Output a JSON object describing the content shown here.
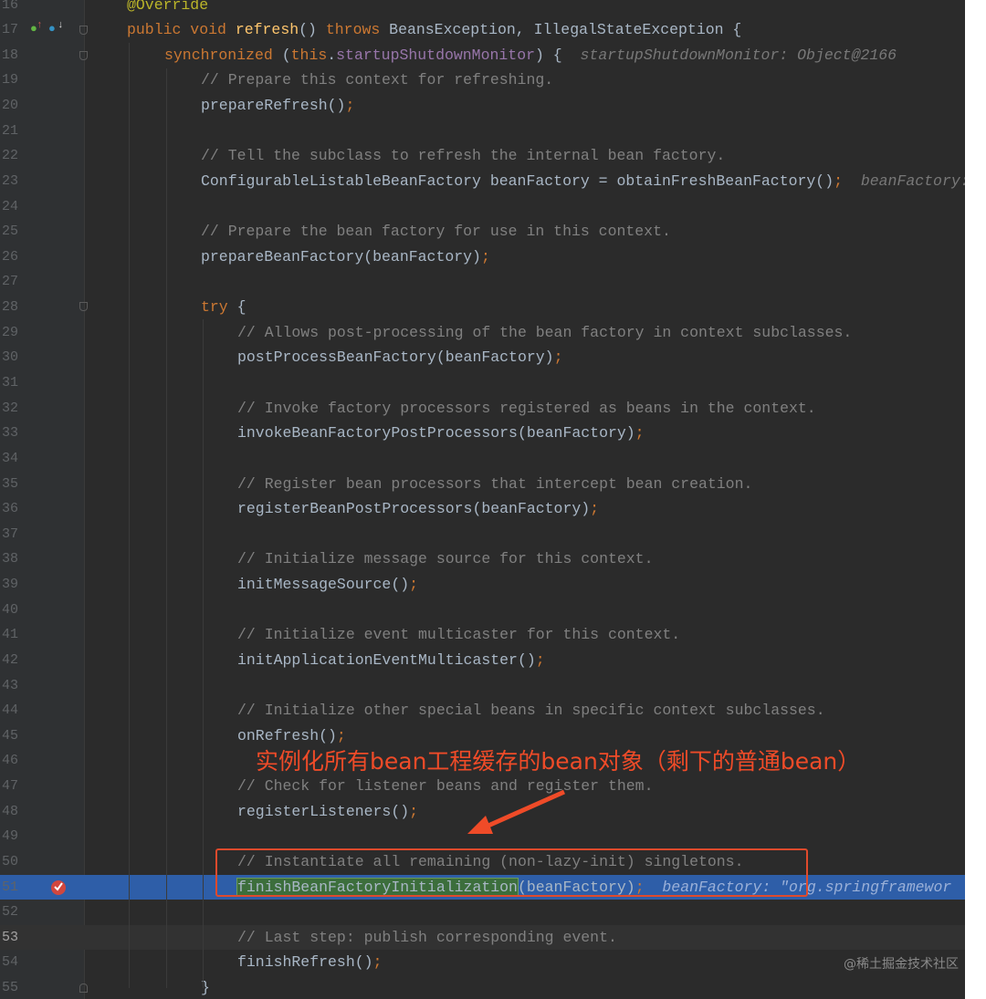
{
  "editor": {
    "first_line": 16,
    "current_line": 53,
    "highlighted_line": 51,
    "lines": [
      {
        "n": "16",
        "indent": 0,
        "t": [
          [
            "@Override",
            "an"
          ]
        ]
      },
      {
        "n": "17",
        "indent": 0,
        "t": [
          [
            "public void ",
            "kw"
          ],
          [
            "refresh",
            "fn"
          ],
          [
            "() ",
            "pl"
          ],
          [
            "throws ",
            "kw"
          ],
          [
            "BeansException, IllegalStateException {",
            "pl"
          ]
        ]
      },
      {
        "n": "18",
        "indent": 1,
        "t": [
          [
            "synchronized ",
            "kw"
          ],
          [
            "(",
            "pl"
          ],
          [
            "this",
            "kw"
          ],
          [
            ".",
            "pl"
          ],
          [
            "startupShutdownMonitor",
            "fld"
          ],
          [
            ") {  ",
            "pl"
          ],
          [
            "startupShutdownMonitor: Object@2166",
            "hint"
          ]
        ]
      },
      {
        "n": "19",
        "indent": 2,
        "t": [
          [
            "// Prepare this context for refreshing.",
            "cm"
          ]
        ]
      },
      {
        "n": "20",
        "indent": 2,
        "t": [
          [
            "prepareRefresh()",
            "pl"
          ],
          [
            ";",
            "kw"
          ]
        ]
      },
      {
        "n": "21",
        "indent": 0,
        "t": []
      },
      {
        "n": "22",
        "indent": 2,
        "t": [
          [
            "// Tell the subclass to refresh the internal bean factory.",
            "cm"
          ]
        ]
      },
      {
        "n": "23",
        "indent": 2,
        "t": [
          [
            "ConfigurableListableBeanFactory beanFactory = obtainFreshBeanFactory()",
            "pl"
          ],
          [
            ";",
            "kw"
          ],
          [
            "  beanFactory: \"org.springframework",
            "hint"
          ]
        ]
      },
      {
        "n": "24",
        "indent": 0,
        "t": []
      },
      {
        "n": "25",
        "indent": 2,
        "t": [
          [
            "// Prepare the bean factory for use in this context.",
            "cm"
          ]
        ]
      },
      {
        "n": "26",
        "indent": 2,
        "t": [
          [
            "prepareBeanFactory(beanFactory)",
            "pl"
          ],
          [
            ";",
            "kw"
          ]
        ]
      },
      {
        "n": "27",
        "indent": 0,
        "t": []
      },
      {
        "n": "28",
        "indent": 2,
        "t": [
          [
            "try ",
            "kw"
          ],
          [
            "{",
            "pl"
          ]
        ]
      },
      {
        "n": "29",
        "indent": 3,
        "t": [
          [
            "// Allows post-processing of the bean factory in context subclasses.",
            "cm"
          ]
        ]
      },
      {
        "n": "30",
        "indent": 3,
        "t": [
          [
            "postProcessBeanFactory(beanFactory)",
            "pl"
          ],
          [
            ";",
            "kw"
          ]
        ]
      },
      {
        "n": "31",
        "indent": 0,
        "t": []
      },
      {
        "n": "32",
        "indent": 3,
        "t": [
          [
            "// Invoke factory processors registered as beans in the context.",
            "cm"
          ]
        ]
      },
      {
        "n": "33",
        "indent": 3,
        "t": [
          [
            "invokeBeanFactoryPostProcessors(beanFactory)",
            "pl"
          ],
          [
            ";",
            "kw"
          ]
        ]
      },
      {
        "n": "34",
        "indent": 0,
        "t": []
      },
      {
        "n": "35",
        "indent": 3,
        "t": [
          [
            "// Register bean processors that intercept bean creation.",
            "cm"
          ]
        ]
      },
      {
        "n": "36",
        "indent": 3,
        "t": [
          [
            "registerBeanPostProcessors(beanFactory)",
            "pl"
          ],
          [
            ";",
            "kw"
          ]
        ]
      },
      {
        "n": "37",
        "indent": 0,
        "t": []
      },
      {
        "n": "38",
        "indent": 3,
        "t": [
          [
            "// Initialize message source for this context.",
            "cm"
          ]
        ]
      },
      {
        "n": "39",
        "indent": 3,
        "t": [
          [
            "initMessageSource()",
            "pl"
          ],
          [
            ";",
            "kw"
          ]
        ]
      },
      {
        "n": "40",
        "indent": 0,
        "t": []
      },
      {
        "n": "41",
        "indent": 3,
        "t": [
          [
            "// Initialize event multicaster for this context.",
            "cm"
          ]
        ]
      },
      {
        "n": "42",
        "indent": 3,
        "t": [
          [
            "initApplicationEventMulticaster()",
            "pl"
          ],
          [
            ";",
            "kw"
          ]
        ]
      },
      {
        "n": "43",
        "indent": 0,
        "t": []
      },
      {
        "n": "44",
        "indent": 3,
        "t": [
          [
            "// Initialize other special beans in specific context subclasses.",
            "cm"
          ]
        ]
      },
      {
        "n": "45",
        "indent": 3,
        "t": [
          [
            "onRefresh()",
            "pl"
          ],
          [
            ";",
            "kw"
          ]
        ]
      },
      {
        "n": "46",
        "indent": 0,
        "t": []
      },
      {
        "n": "47",
        "indent": 3,
        "t": [
          [
            "// Check for listener beans and register them.",
            "cm"
          ]
        ]
      },
      {
        "n": "48",
        "indent": 3,
        "t": [
          [
            "registerListeners()",
            "pl"
          ],
          [
            ";",
            "kw"
          ]
        ]
      },
      {
        "n": "49",
        "indent": 0,
        "t": []
      },
      {
        "n": "50",
        "indent": 3,
        "t": [
          [
            "// Instantiate all remaining (non-lazy-init) singletons.",
            "cm"
          ]
        ]
      },
      {
        "n": "51",
        "indent": 3,
        "t": [
          [
            "finishBeanFactoryInitialization",
            "sel"
          ],
          [
            "(beanFactory)",
            "pl"
          ],
          [
            ";",
            "kw"
          ],
          [
            "  beanFactory: \"org.springframewor",
            "hint"
          ]
        ]
      },
      {
        "n": "52",
        "indent": 0,
        "t": []
      },
      {
        "n": "53",
        "indent": 3,
        "t": [
          [
            "// Last step: publish corresponding event.",
            "cm"
          ]
        ]
      },
      {
        "n": "54",
        "indent": 3,
        "t": [
          [
            "finishRefresh()",
            "pl"
          ],
          [
            ";",
            "kw"
          ]
        ]
      },
      {
        "n": "55",
        "indent": 2,
        "t": [
          [
            "}",
            "pl"
          ]
        ]
      }
    ]
  },
  "annotation": {
    "note": "实例化所有bean工程缓存的bean对象（剩下的普通bean）",
    "color": "#ef4b28"
  },
  "watermark": "@稀土掘金技术社区"
}
